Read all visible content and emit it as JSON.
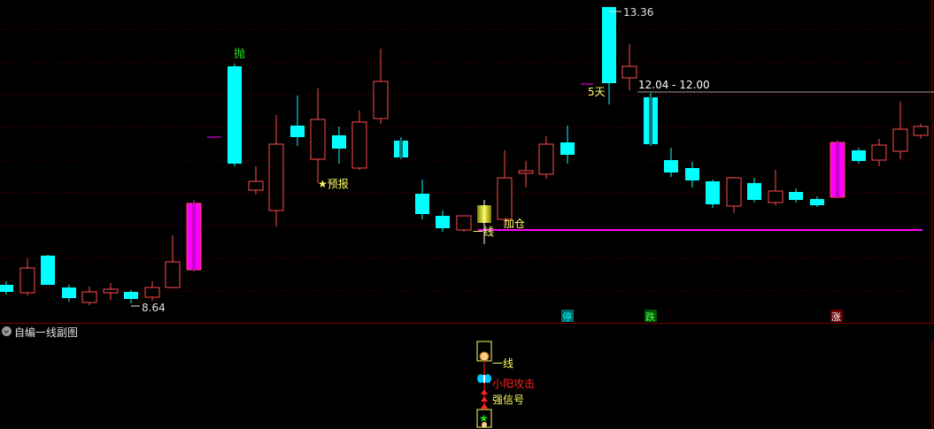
{
  "main_chart": {
    "annotations": {
      "pao": "抛",
      "high_price": "13.36",
      "five_days": "5天",
      "range": "12.04 - 12.00",
      "yubao": "★预报",
      "yixian": "一线",
      "jiacang": "加仓",
      "low_price": "8.64"
    },
    "badges": {
      "ting": "停",
      "die": "跌",
      "zhang": "涨"
    }
  },
  "sub_chart": {
    "title": "自编一线副图",
    "labels": {
      "yixian": "一线",
      "xiaoyang": "小阳攻击",
      "qiangxinhao": "强信号"
    }
  },
  "colors": {
    "up": "#ff4d4d",
    "down": "#00ffff",
    "magenta": "#ff00ff",
    "yellow": "#ffff66",
    "grid": "#7a0000"
  }
}
